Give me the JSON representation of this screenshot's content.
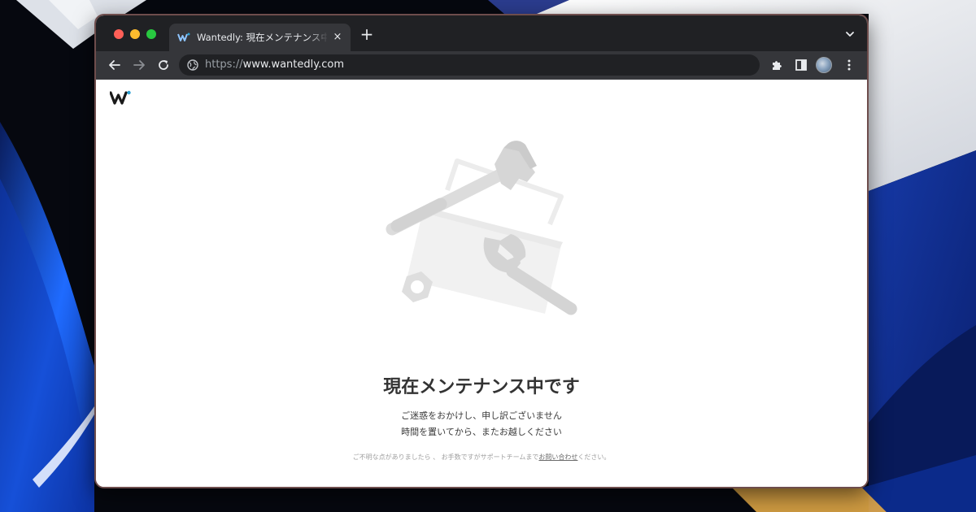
{
  "browser": {
    "tab": {
      "title": "Wantedly: 現在メンテナンス中です",
      "favicon": "wantedly-favicon-icon",
      "close_icon": "×"
    },
    "new_tab_icon": "+",
    "address": {
      "scheme": "https://",
      "host": "www.wantedly.com"
    }
  },
  "page": {
    "logo": "wantedly-logo",
    "illustration": "maintenance-tools-illustration",
    "headline": "現在メンテナンス中です",
    "subtitle_line1": "ご迷惑をおかけし、申し訳ございません",
    "subtitle_line2": "時間を置いてから、またお越しください",
    "contact_prefix": "ご不明な点がありましたら 、 お手数ですがサポートチームまで",
    "contact_link": "お問い合わせ",
    "contact_suffix": "ください。"
  },
  "colors": {
    "tabstrip": "#202124",
    "toolbar": "#35363a",
    "accent_dot": "#2ca1d3",
    "window_border": "#6e4d4c"
  }
}
